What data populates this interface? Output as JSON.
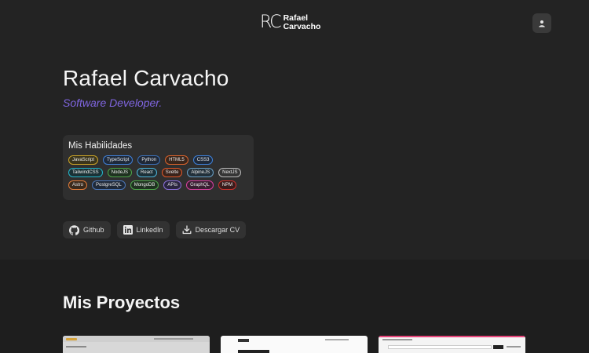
{
  "header": {
    "logo_mark": "RC",
    "logo_line1": "Rafael",
    "logo_line2": "Carvacho"
  },
  "hero": {
    "name": "Rafael Carvacho",
    "role": "Software Developer."
  },
  "skills": {
    "title": "Mis Habilidades",
    "tags": [
      {
        "label": "JavaScript",
        "color": "#c9a227",
        "bg": "#3b351c"
      },
      {
        "label": "TypeScript",
        "color": "#3f7fd6",
        "bg": "#1e2a3c"
      },
      {
        "label": "Python",
        "color": "#3b6fb5",
        "bg": "#1f2837"
      },
      {
        "label": "HTML5",
        "color": "#d9622b",
        "bg": "#3a261c"
      },
      {
        "label": "CSS3",
        "color": "#3d7fd6",
        "bg": "#1e2a3c"
      },
      {
        "label": "TailwindCSS",
        "color": "#24b6c9",
        "bg": "#1a3236"
      },
      {
        "label": "NodeJS",
        "color": "#4da44a",
        "bg": "#1f3220"
      },
      {
        "label": "React",
        "color": "#4fb4d8",
        "bg": "#1b3038"
      },
      {
        "label": "Svelte",
        "color": "#e0582a",
        "bg": "#3a231b"
      },
      {
        "label": "AlpineJS",
        "color": "#6a9fc5",
        "bg": "#22303a"
      },
      {
        "label": "NextJS",
        "color": "#bbbbbb",
        "bg": "#353535"
      },
      {
        "label": "Astro",
        "color": "#e07b39",
        "bg": "#3a2a1c"
      },
      {
        "label": "PostgreSQL",
        "color": "#4c77b8",
        "bg": "#1f2938"
      },
      {
        "label": "MongoDB",
        "color": "#4da44a",
        "bg": "#1f3220"
      },
      {
        "label": "APIs",
        "color": "#8a6fd8",
        "bg": "#2a2540"
      },
      {
        "label": "GraphQL",
        "color": "#d6409f",
        "bg": "#3a1f32"
      },
      {
        "label": "NPM",
        "color": "#c9302c",
        "bg": "#3a1c1c"
      }
    ]
  },
  "links": {
    "github": "Github",
    "linkedin": "LinkedIn",
    "cv": "Descargar CV"
  },
  "projects": {
    "title": "Mis Proyectos"
  },
  "colors": {
    "accent": "#7f65e0",
    "hero_bg": "#232323",
    "page_bg": "#1e1e1e"
  }
}
